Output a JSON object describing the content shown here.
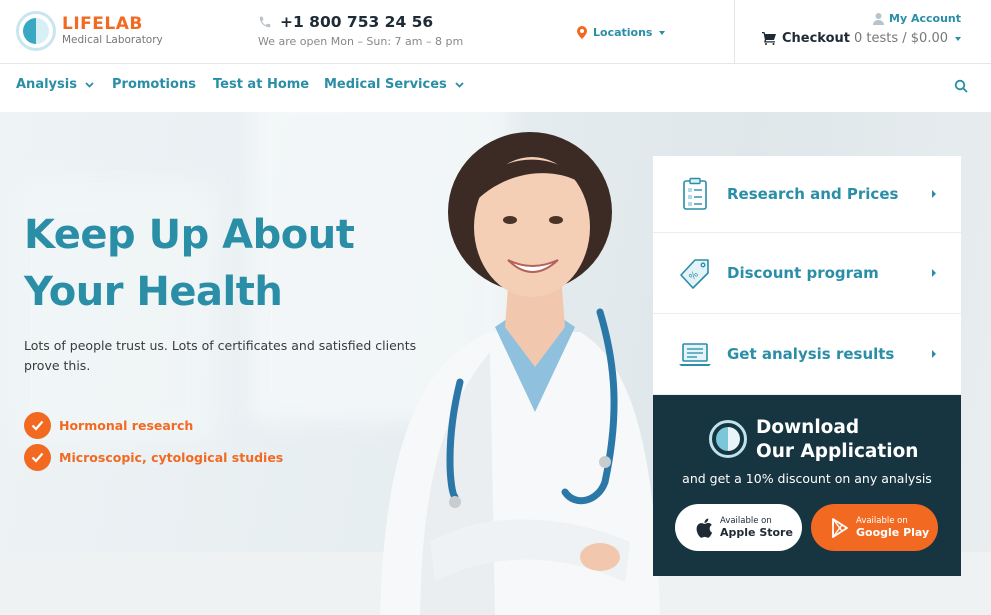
{
  "logo": {
    "name": "LIFELAB",
    "tagline": "Medical Laboratory"
  },
  "contact": {
    "phone": "+1 800 753 24 56",
    "hours": "We are open Mon – Sun: 7 am – 8 pm"
  },
  "locations": {
    "label": "Locations"
  },
  "account": {
    "label": "My Account"
  },
  "checkout": {
    "label": "Checkout",
    "info": "0 tests / $0.00"
  },
  "nav": {
    "items": [
      {
        "label": "Analysis",
        "has_dropdown": true
      },
      {
        "label": "Promotions",
        "has_dropdown": false
      },
      {
        "label": "Test at Home",
        "has_dropdown": false
      },
      {
        "label": "Medical Services",
        "has_dropdown": true
      }
    ]
  },
  "hero": {
    "title_line1": "Keep Up About",
    "title_line2": "Your Health",
    "subtitle": "Lots of people trust us. Lots of certificates and satisfied clients prove this.",
    "features": [
      "Hormonal research",
      "Microscopic, cytological studies"
    ]
  },
  "panel": {
    "items": [
      {
        "label": "Research and Prices",
        "icon": "clipboard-icon"
      },
      {
        "label": "Discount program",
        "icon": "discount-tag-icon"
      },
      {
        "label": "Get analysis results",
        "icon": "laptop-icon"
      }
    ]
  },
  "app": {
    "title_line1": "Download",
    "title_line2": "Our Application",
    "subtitle": "and get a 10% discount on any analysis",
    "apple": {
      "small": "Available on",
      "big": "Apple Store"
    },
    "google": {
      "small": "Available on",
      "big": "Google Play"
    }
  },
  "colors": {
    "primary": "#2a8ea7",
    "accent": "#f26a21",
    "dark": "#163540"
  }
}
